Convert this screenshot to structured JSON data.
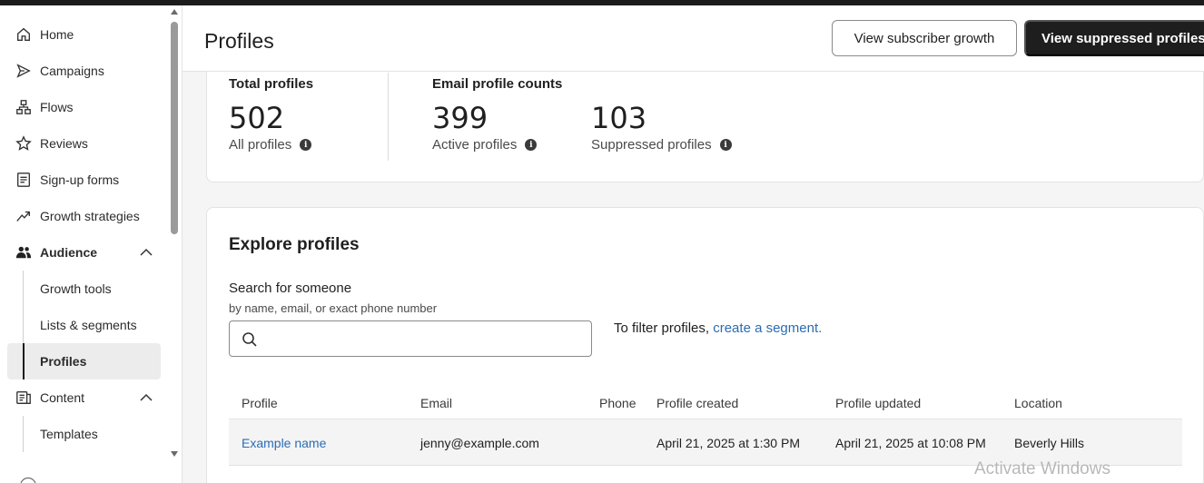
{
  "sidebar": {
    "items": [
      {
        "label": "Home",
        "icon": "home-icon"
      },
      {
        "label": "Campaigns",
        "icon": "send-icon"
      },
      {
        "label": "Flows",
        "icon": "flow-icon"
      },
      {
        "label": "Reviews",
        "icon": "star-icon"
      },
      {
        "label": "Sign-up forms",
        "icon": "form-icon"
      },
      {
        "label": "Growth strategies",
        "icon": "trend-icon"
      },
      {
        "label": "Audience",
        "icon": "people-icon",
        "expanded": true
      },
      {
        "label": "Content",
        "icon": "content-icon",
        "expanded": true
      }
    ],
    "audience_sub": [
      {
        "label": "Growth tools"
      },
      {
        "label": "Lists & segments"
      },
      {
        "label": "Profiles",
        "active": true
      }
    ],
    "content_sub": [
      {
        "label": "Templates"
      }
    ]
  },
  "header": {
    "title": "Profiles",
    "view_growth_label": "View subscriber growth",
    "view_suppressed_label": "View suppressed profiles"
  },
  "stats": {
    "total_label": "Total profiles",
    "total_value": "502",
    "total_sub": "All profiles",
    "email_label": "Email profile counts",
    "active_value": "399",
    "active_sub": "Active profiles",
    "suppressed_value": "103",
    "suppressed_sub": "Suppressed profiles"
  },
  "explore": {
    "title": "Explore profiles",
    "search_label": "Search for someone",
    "search_hint": "by name, email, or exact phone number",
    "search_value": "",
    "filter_prefix": "To filter profiles,",
    "filter_link": "create a segment.",
    "columns": [
      "Profile",
      "Email",
      "Phone",
      "Profile created",
      "Profile updated",
      "Location"
    ],
    "rows": [
      {
        "profile": "Example name",
        "email": "jenny@example.com",
        "phone": "",
        "created": "April 21, 2025 at 1:30 PM",
        "updated": "April 21, 2025 at 10:08 PM",
        "location": "Beverly Hills"
      }
    ]
  },
  "watermark": "Activate Windows"
}
